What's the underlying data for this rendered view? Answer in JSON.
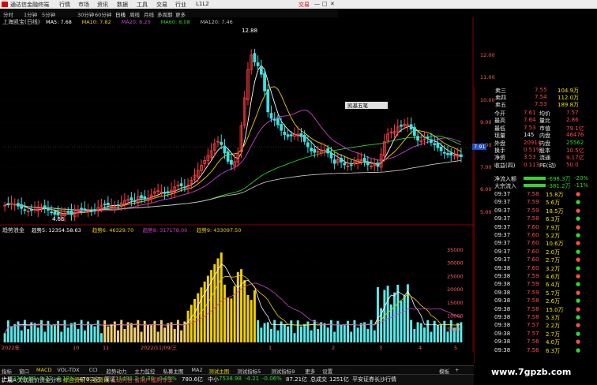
{
  "menubar": {
    "title": "通达信金融终端",
    "items": [
      "行情",
      "市场",
      "资讯",
      "数据",
      "工具",
      "交易",
      "行业",
      "L1L2"
    ],
    "trade": "交易",
    "controls": [
      "—",
      "□",
      "✕"
    ]
  },
  "periods": [
    "分时",
    "1分钟",
    "5分钟",
    "30分钟",
    "60分钟",
    "日线",
    "周线",
    "月线",
    "多周期",
    "更多"
  ],
  "kline": {
    "title": "上海凯宝(日线)",
    "ma": [
      {
        "label": "MA5: 7.68",
        "color": "#ffffff"
      },
      {
        "label": "MA10: 7.82",
        "color": "#f0d000"
      },
      {
        "label": "MA20: 8.20",
        "color": "#d040d0"
      },
      {
        "label": "MA60: 8.08",
        "color": "#30d030"
      },
      {
        "label": "MA120: 7.46",
        "color": "#c0c0c0"
      }
    ],
    "prices": [
      "12.00",
      "11.00",
      "10.00",
      "9.00",
      "8.00",
      "7.91",
      "7.00",
      "6.00",
      "5.00"
    ],
    "high_label": "12.88",
    "low_label": "4.86",
    "current_price_tag": "7.91",
    "popup_label": "凯基五笔"
  },
  "volume": {
    "title": "趋势浪金",
    "legends": [
      {
        "label": "趋势5: 12354.58.63",
        "color": "#ffffff"
      },
      {
        "label": "趋势6: 46329.70",
        "color": "#f0d000"
      },
      {
        "label": "趋势8: 317178.00",
        "color": "#d040d0"
      },
      {
        "label": "趋势9: 433097.50",
        "color": "#f0d000"
      }
    ],
    "axis": [
      "35000",
      "30000",
      "25000",
      "20000",
      "15000",
      "10000",
      "5000"
    ],
    "dates": [
      "2022年",
      "10",
      "11",
      "2022/11/09/三",
      "1",
      "2",
      "3",
      "4",
      "5"
    ]
  },
  "quote": {
    "ask": [
      {
        "label": "卖三",
        "price": "7.55",
        "vol": "104.9万"
      },
      {
        "label": "卖四",
        "price": "7.54",
        "vol": "112.0万"
      },
      {
        "label": "卖五",
        "price": "7.53",
        "vol": "189.8万"
      }
    ],
    "stats": [
      {
        "l1": "今开",
        "v1": "7.61",
        "l2": "均价",
        "v2": "7.57"
      },
      {
        "l1": "最高",
        "v1": "7.64",
        "l2": "量比",
        "v2": "2.86"
      },
      {
        "l1": "最低",
        "v1": "7.53",
        "l2": "市值",
        "v2": "79.1亿"
      },
      {
        "l1": "现量",
        "v1": "145",
        "l2": "内盘",
        "v2": "46476"
      },
      {
        "l1": "外盘",
        "v1": "20914",
        "l2": "内盘",
        "v2": "25562"
      },
      {
        "l1": "换手",
        "v1": "0.51%",
        "l2": "股本",
        "v2": "10.5亿"
      },
      {
        "l1": "净资",
        "v1": "3.53",
        "l2": "流通",
        "v2": "9.17亿"
      },
      {
        "l1": "收益(四)",
        "v1": "0.113",
        "l2": "PE(动)",
        "v2": "50.0"
      }
    ],
    "flows": [
      {
        "label": "净流入额",
        "value": "-698.3万",
        "pct": "-20%"
      },
      {
        "label": "大宗流入",
        "value": "-381.2万",
        "pct": "-11%"
      }
    ],
    "ticks": [
      {
        "t": "09:37",
        "p": "7.58",
        "v": "15.8万"
      },
      {
        "t": "09:37",
        "p": "7.59",
        "v": "5.6万"
      },
      {
        "t": "09:37",
        "p": "7.59",
        "v": "18.5万"
      },
      {
        "t": "09:37",
        "p": "7.58",
        "v": "6.3万"
      },
      {
        "t": "09:37",
        "p": "7.60",
        "v": "7.9万"
      },
      {
        "t": "09:37",
        "p": "7.60",
        "v": "5.2万"
      },
      {
        "t": "09:37",
        "p": "7.60",
        "v": "10.6万"
      },
      {
        "t": "09:37",
        "p": "7.60",
        "v": "2.0万"
      },
      {
        "t": "09:37",
        "p": "7.60",
        "v": "2.7万"
      },
      {
        "t": "09:38",
        "p": "7.60",
        "v": "3.2万"
      },
      {
        "t": "09:38",
        "p": "7.59",
        "v": "4.6万"
      },
      {
        "t": "09:38",
        "p": "7.59",
        "v": "6.4万"
      },
      {
        "t": "09:38",
        "p": "7.59",
        "v": "5.7万"
      },
      {
        "t": "09:38",
        "p": "7.58",
        "v": "2.6万"
      },
      {
        "t": "09:38",
        "p": "7.58",
        "v": "15.0万"
      },
      {
        "t": "09:38",
        "p": "7.58",
        "v": "5.3万"
      },
      {
        "t": "09:38",
        "p": "7.57",
        "v": "2.2万"
      },
      {
        "t": "09:38",
        "p": "7.57",
        "v": "2.7万"
      },
      {
        "t": "09:38",
        "p": "7.56",
        "v": "4.0万"
      },
      {
        "t": "09:38",
        "p": "7.56",
        "v": "6.3万"
      }
    ]
  },
  "bottom_tabs": [
    "指标",
    "窗口",
    "MACD",
    "VOL-TDX",
    "CCI",
    "趋势动力",
    "主力监控",
    "私募主图",
    "MA2",
    "测试主图",
    "测试指标5",
    "测试指标9",
    "更多",
    "设置"
  ],
  "bottom_tabs_right": [
    "模板",
    "+"
  ],
  "statusbar": {
    "left": [
      "扩展A",
      "关联股价",
      "资金分布",
      "综合资讯",
      "行业资讯",
      "互动问答",
      "省用户福利专享"
    ],
    "idx1_name": "上证",
    "idx1_val": "3261.98",
    "idx1_chg": "-3.77",
    "idx1_pct": "-0.12%",
    "idx1_amt": "470.1亿",
    "idx2_name": "深证",
    "idx2_val": "11491.2",
    "idx2_chg": "-5.70",
    "idx2_pct": "-0.05%",
    "idx2_amt": "780.6亿",
    "idx3_name": "中小",
    "idx3_val": "7538.98",
    "idx3_chg": "-4.21",
    "idx3_pct": "-0.06%",
    "idx3_amt": "87.21亿",
    "total_label": "总成交",
    "total_val": "1251亿",
    "ticker": "平安证券长沙行情"
  },
  "watermark": "www.7gpzb.com",
  "colors": {
    "up": "#ff4040",
    "down": "#40e0e0",
    "ma5": "#ffffff",
    "ma10": "#f0d000",
    "ma20": "#d040d0",
    "ma60": "#30d030",
    "ma120": "#c0c0c0"
  }
}
